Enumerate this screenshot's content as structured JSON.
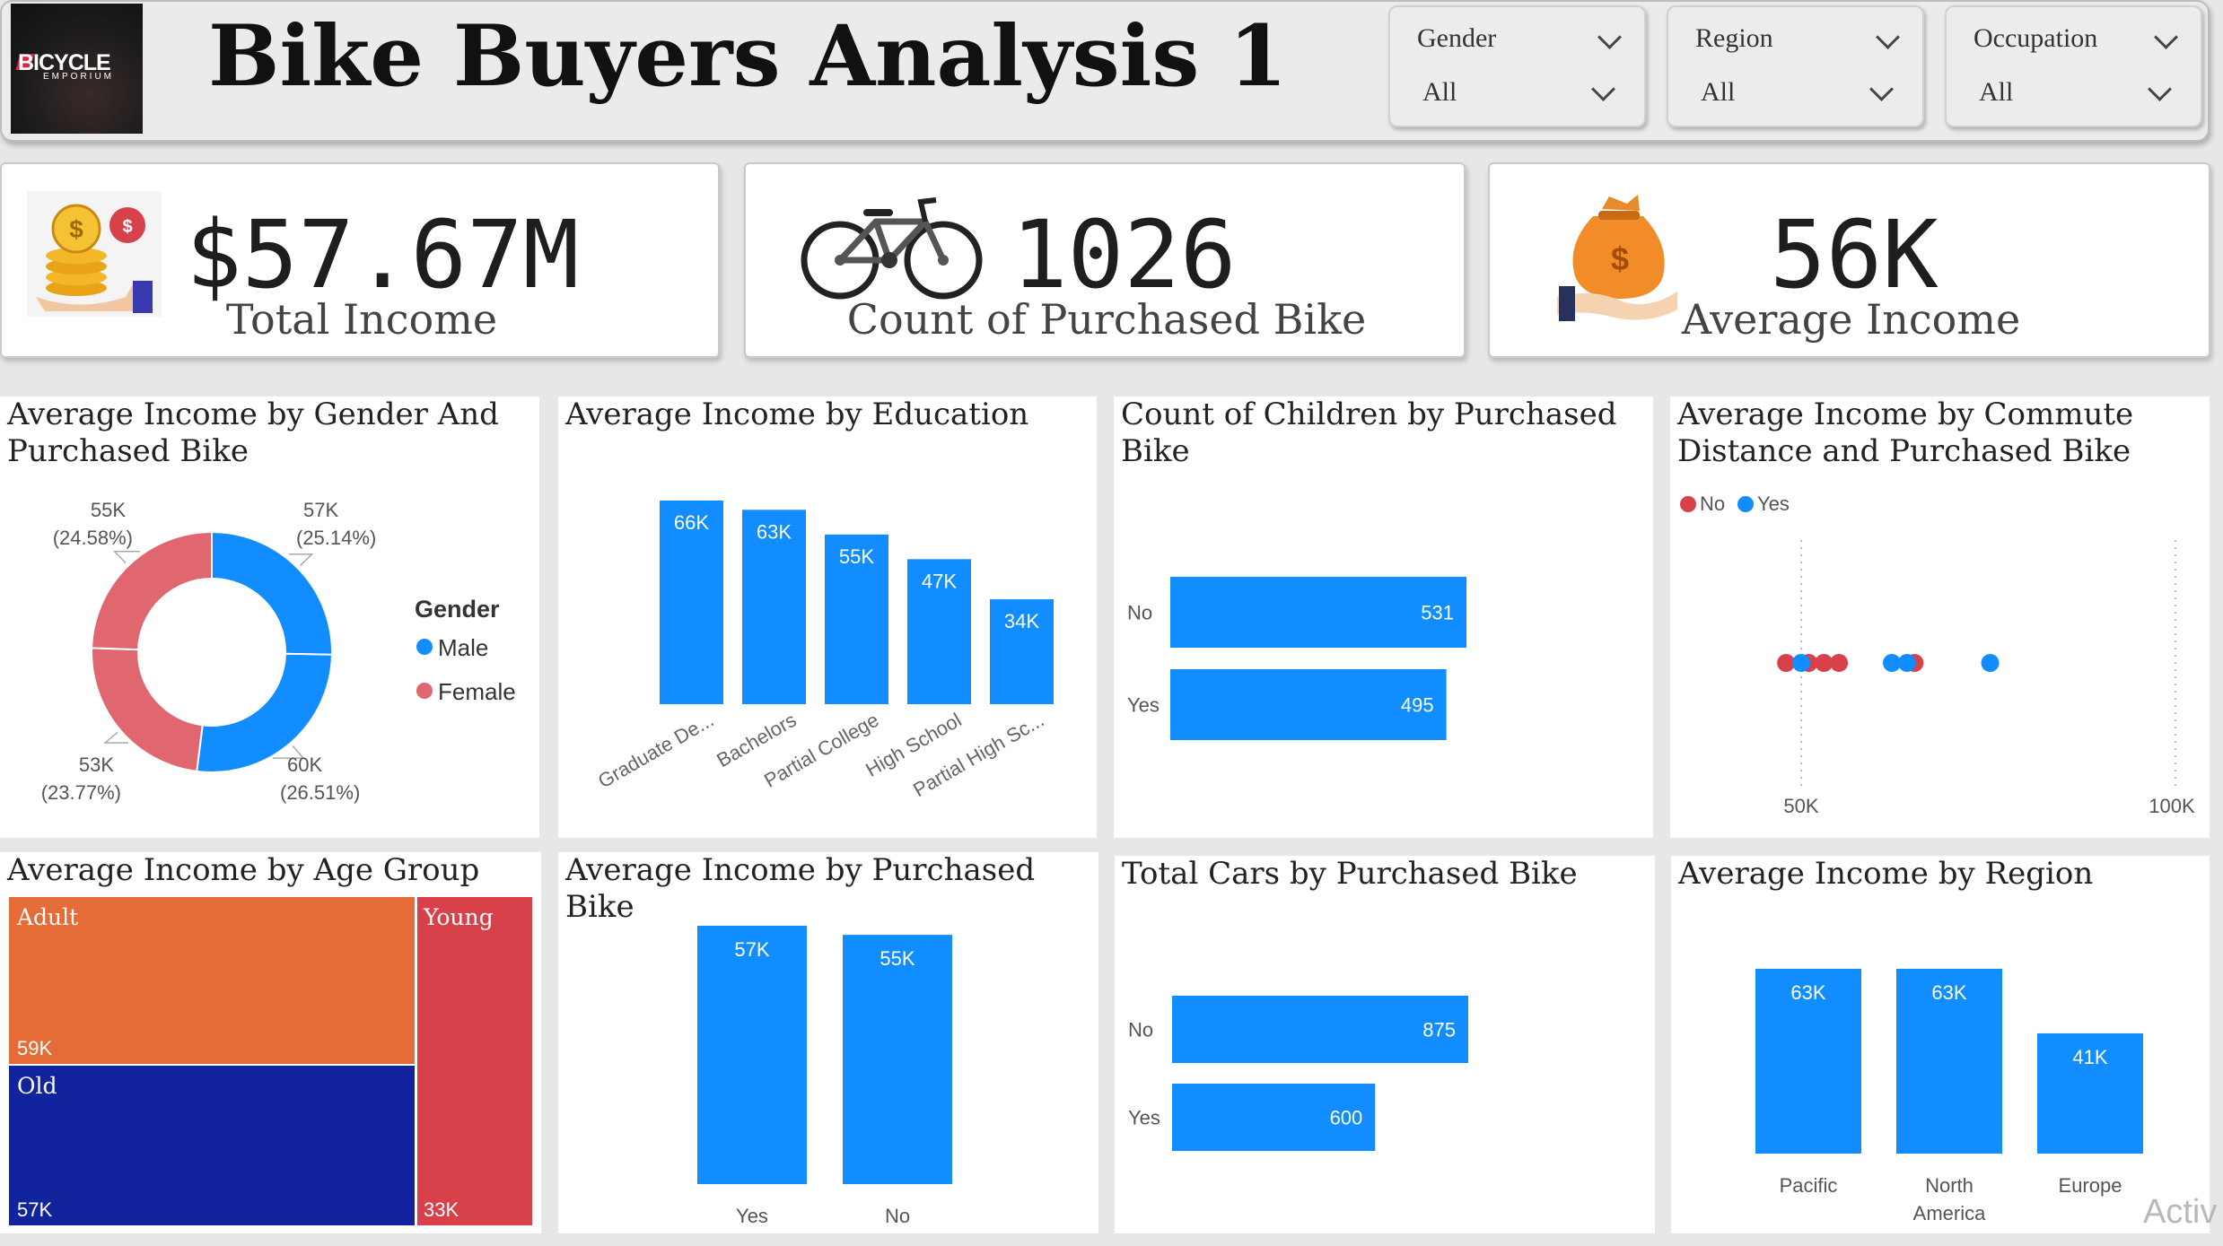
{
  "header": {
    "logo_text": "BICYCLE",
    "logo_sub": "EMPORIUM",
    "title": "Bike Buyers Analysis 1"
  },
  "slicers": [
    {
      "label": "Gender",
      "value": "All"
    },
    {
      "label": "Region",
      "value": "All"
    },
    {
      "label": "Occupation",
      "value": "All"
    }
  ],
  "kpis": [
    {
      "value": "$57.67M",
      "label": "Total Income",
      "icon": "money-stack-icon"
    },
    {
      "value": "1026",
      "label": "Count of Purchased Bike",
      "icon": "bicycle-icon"
    },
    {
      "value": "56K",
      "label": "Average Income",
      "icon": "money-bag-hand-icon"
    }
  ],
  "colors": {
    "blue": "#118dff",
    "red": "#e0676f",
    "orange": "#e66c37",
    "navy": "#12239e",
    "crimson": "#d9414a"
  },
  "panels": {
    "gender": {
      "title_line1": "Average Income by Gender And",
      "title_line2": "Purchased Bike",
      "legend_title": "Gender",
      "legend_male": "Male",
      "legend_female": "Female"
    },
    "education": {
      "title": "Average Income by Education"
    },
    "children": {
      "title_line1": "Count of Children by Purchased",
      "title_line2": "Bike"
    },
    "commute": {
      "title_line1": "Average Income by Commute",
      "title_line2": "Distance and Purchased Bike",
      "legend_no": "No",
      "legend_yes": "Yes"
    },
    "age": {
      "title": "Average Income by Age Group"
    },
    "purchased": {
      "title": "Average Income by Purchased Bike"
    },
    "cars": {
      "title": "Total Cars by Purchased Bike"
    },
    "region": {
      "title": "Average Income by Region"
    }
  },
  "watermark": "Activ",
  "chart_data": [
    {
      "type": "pie",
      "title": "Average Income by Gender And Purchased Bike",
      "legend": "Gender",
      "slices": [
        {
          "gender": "Male",
          "value": 57,
          "label": "57K",
          "pct": "(25.14%)"
        },
        {
          "gender": "Male",
          "value": 60,
          "label": "60K",
          "pct": "(26.51%)"
        },
        {
          "gender": "Female",
          "value": 53,
          "label": "53K",
          "pct": "(23.77%)"
        },
        {
          "gender": "Female",
          "value": 55,
          "label": "55K",
          "pct": "(24.58%)"
        }
      ]
    },
    {
      "type": "bar",
      "title": "Average Income by Education",
      "categories": [
        "Graduate De...",
        "Bachelors",
        "Partial College",
        "High School",
        "Partial High Sc..."
      ],
      "values": [
        66,
        63,
        55,
        47,
        34
      ],
      "labels": [
        "66K",
        "63K",
        "55K",
        "47K",
        "34K"
      ]
    },
    {
      "type": "bar",
      "orientation": "horizontal",
      "title": "Count of Children by Purchased Bike",
      "categories": [
        "No",
        "Yes"
      ],
      "values": [
        531,
        495
      ],
      "labels": [
        "531",
        "495"
      ]
    },
    {
      "type": "scatter",
      "title": "Average Income by Commute Distance and Purchased Bike",
      "series": [
        {
          "name": "No",
          "x": [
            48,
            51,
            53,
            55,
            65
          ],
          "y": [
            0,
            0,
            0,
            0,
            0
          ]
        },
        {
          "name": "Yes",
          "x": [
            50,
            62,
            64,
            75
          ],
          "y": [
            0,
            0,
            0,
            0
          ]
        }
      ],
      "xticks": [
        "50K",
        "100K"
      ],
      "xtick_values": [
        50,
        100
      ]
    },
    {
      "type": "heatmap",
      "title": "Average Income by Age Group",
      "cells": [
        {
          "name": "Adult",
          "value": "59K"
        },
        {
          "name": "Old",
          "value": "57K"
        },
        {
          "name": "Young",
          "value": "33K"
        }
      ]
    },
    {
      "type": "bar",
      "title": "Average Income by Purchased Bike",
      "categories": [
        "Yes",
        "No"
      ],
      "values": [
        57,
        55
      ],
      "labels": [
        "57K",
        "55K"
      ]
    },
    {
      "type": "bar",
      "orientation": "horizontal",
      "title": "Total Cars by Purchased Bike",
      "categories": [
        "No",
        "Yes"
      ],
      "values": [
        875,
        600
      ],
      "labels": [
        "875",
        "600"
      ]
    },
    {
      "type": "bar",
      "title": "Average Income by Region",
      "categories": [
        "Pacific",
        "North America",
        "Europe"
      ],
      "category_lines": [
        [
          "Pacific"
        ],
        [
          "North",
          "America"
        ],
        [
          "Europe"
        ]
      ],
      "values": [
        63,
        63,
        41
      ],
      "labels": [
        "63K",
        "63K",
        "41K"
      ]
    }
  ]
}
